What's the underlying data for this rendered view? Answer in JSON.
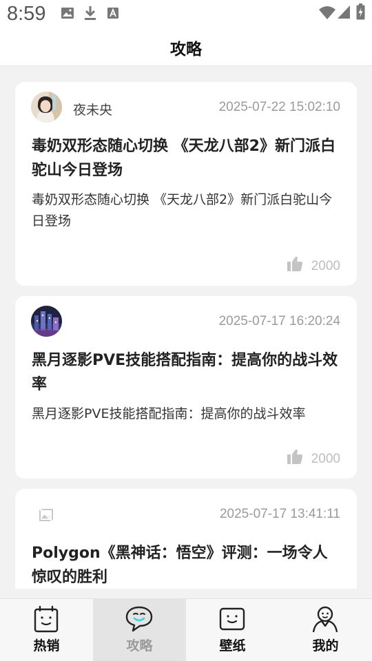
{
  "status_bar": {
    "time": "8:59",
    "icons": [
      "image-icon",
      "download-icon",
      "font-icon",
      "wifi-icon",
      "signal-icon",
      "battery-charging-icon"
    ]
  },
  "header": {
    "title": "攻略"
  },
  "articles": [
    {
      "author": "夜未央",
      "avatar": "avatar-portrait",
      "timestamp": "2025-07-22 15:02:10",
      "title": "毒奶双形态随心切换 《天龙八部2》新门派白驼山今日登场",
      "summary": "毒奶双形态随心切换 《天龙八部2》新门派白驼山今日登场",
      "likes": "2000"
    },
    {
      "author": "",
      "avatar": "avatar-city-night",
      "timestamp": "2025-07-17 16:20:24",
      "title": "黑月逐影PVE技能搭配指南：提高你的战斗效率",
      "summary": "黑月逐影PVE技能搭配指南：提高你的战斗效率",
      "likes": "2000"
    },
    {
      "author": "",
      "avatar": "broken-image-icon",
      "timestamp": "2025-07-17 13:41:11",
      "title": "Polygon《黑神话：悟空》评测：一场令人惊叹的胜利",
      "summary": "",
      "likes": ""
    }
  ],
  "bottom_nav": [
    {
      "label": "热销",
      "icon": "shopping-bag-icon",
      "active": false
    },
    {
      "label": "攻略",
      "icon": "chat-bubble-icon",
      "active": true
    },
    {
      "label": "壁纸",
      "icon": "wallpaper-icon",
      "active": false
    },
    {
      "label": "我的",
      "icon": "profile-icon",
      "active": false
    }
  ],
  "colors": {
    "background": "#f2f2f2",
    "card": "#ffffff",
    "accent_cyan": "#36d6de",
    "muted_text": "#9a9a9a",
    "like_gray": "#c4c4c4"
  }
}
